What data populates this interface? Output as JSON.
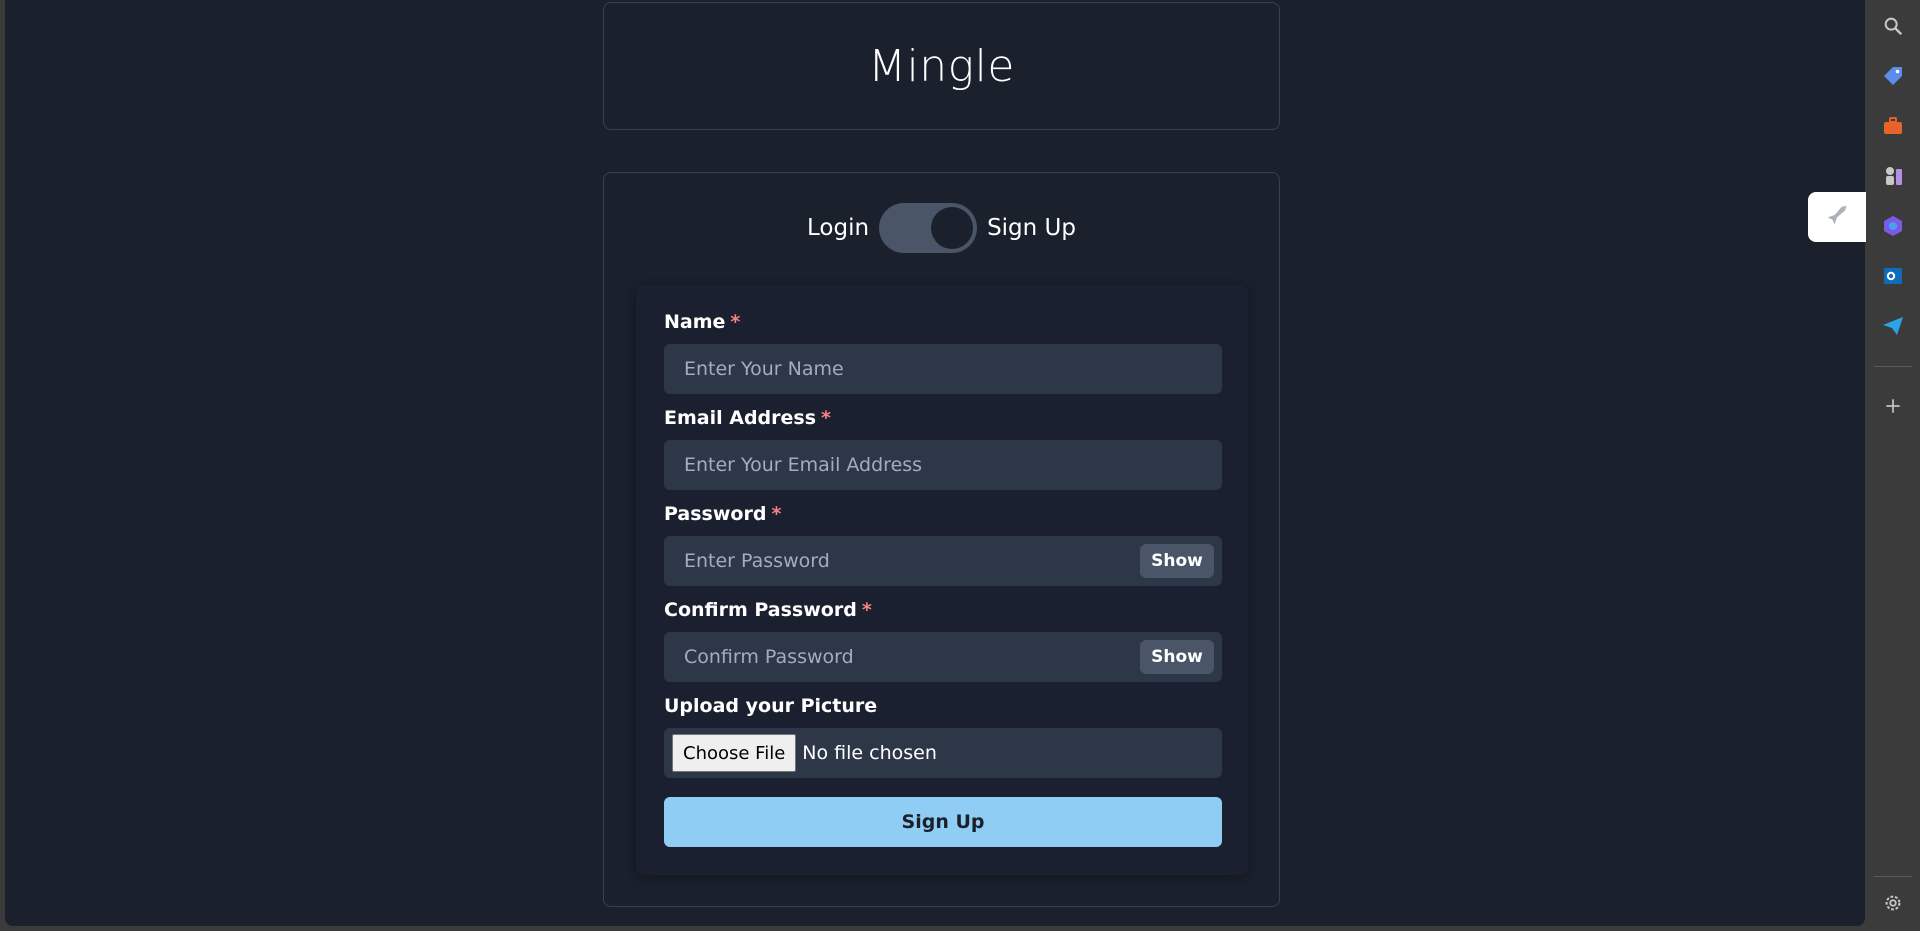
{
  "app": {
    "title": "Mingle"
  },
  "toggle": {
    "left_label": "Login",
    "right_label": "Sign Up",
    "state": "Sign Up"
  },
  "form": {
    "name": {
      "label": "Name",
      "required_mark": "*",
      "placeholder": "Enter Your Name"
    },
    "email": {
      "label": "Email Address",
      "required_mark": "*",
      "placeholder": "Enter Your Email Address"
    },
    "password": {
      "label": "Password",
      "required_mark": "*",
      "placeholder": "Enter Password",
      "toggle_label": "Show"
    },
    "confirm_password": {
      "label": "Confirm Password",
      "required_mark": "*",
      "placeholder": "Confirm Password",
      "toggle_label": "Show"
    },
    "picture": {
      "label": "Upload your Picture",
      "button_label": "Choose File",
      "status": "No file chosen"
    },
    "submit_label": "Sign Up"
  },
  "colors": {
    "background": "#1a202c",
    "input_bg": "#2d3748",
    "required": "#fc8181",
    "submit_bg": "#90cdf4",
    "switch_track": "#4a5568"
  },
  "sidebar": {
    "icons": [
      "search-icon",
      "tag-icon",
      "briefcase-icon",
      "chess-icon",
      "copilot-icon",
      "outlook-icon",
      "send-icon",
      "add-icon",
      "settings-icon"
    ],
    "flyout_icon": "rocket-icon"
  }
}
